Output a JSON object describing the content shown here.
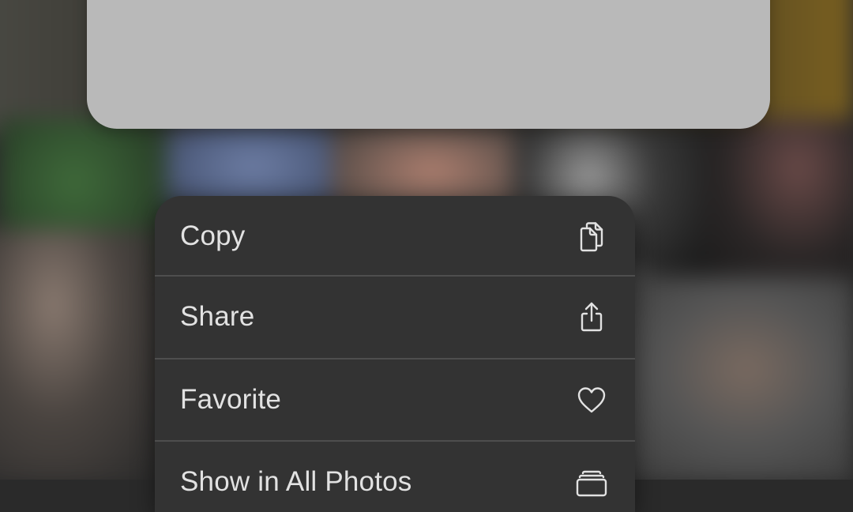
{
  "menu": {
    "items": [
      {
        "label": "Copy",
        "icon": "copy-icon"
      },
      {
        "label": "Share",
        "icon": "share-icon"
      },
      {
        "label": "Favorite",
        "icon": "heart-icon"
      },
      {
        "label": "Show in All Photos",
        "icon": "photos-stack-icon"
      }
    ]
  },
  "colors": {
    "menu_background": "#333333",
    "menu_text": "#e2e2e2",
    "divider": "#4e4e4e",
    "preview_card": "#b9b9b9"
  }
}
